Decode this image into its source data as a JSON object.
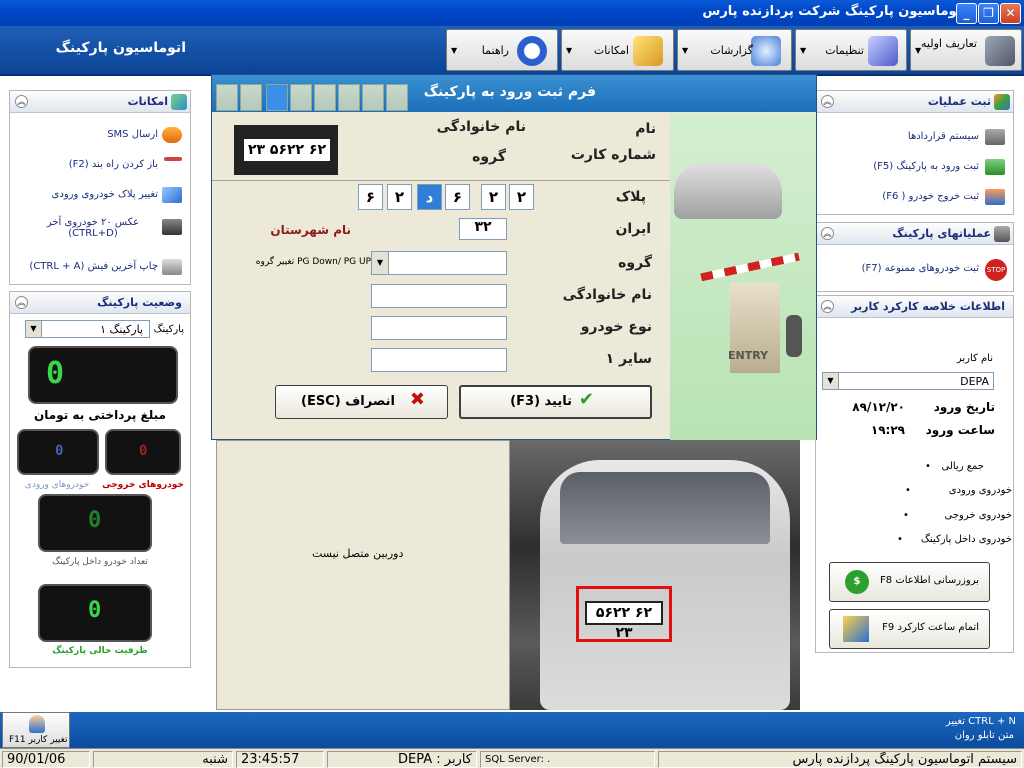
{
  "window": {
    "title": "اتوماسیون پارکینگ شرکت پردازنده پارس",
    "min": "_",
    "max": "❐",
    "close": "✕"
  },
  "app": {
    "title": "اتوماسیون پارکینگ"
  },
  "menu": {
    "initial": "تعاریف اولیه",
    "settings": "تنظیمات",
    "reports": "گزارشات",
    "features": "امکانات",
    "help": "راهنما"
  },
  "left_features": {
    "title": "امکانات",
    "items": [
      {
        "label": "ارسال SMS"
      },
      {
        "label": "باز کردن راه بند (F2)"
      },
      {
        "label": "تغییر پلاک خودروی ورودی"
      },
      {
        "label": "عکس ۲۰ خودروی آخر (CTRL+D)"
      },
      {
        "label": "چاپ آخرین فیش (CTRL + A)"
      }
    ]
  },
  "parking_status": {
    "title": "وضعیت پارکینگ",
    "parking_label": "پارکینگ",
    "parking_value": "پارکینگ ۱",
    "payment_value": "0",
    "payment_caption": "مبلغ پرداختی به تومان",
    "exit_value": "0",
    "exit_caption": "خودروهای خروجی",
    "enter_value": "0",
    "enter_caption": "خودروهای ورودی",
    "inside_value": "0",
    "inside_caption": "تعداد خودرو داخل پارکینگ",
    "free_value": "0",
    "free_caption": "ظرفیت خالی پارکینگ"
  },
  "right_ops": {
    "title": "ثبت عملیات",
    "items": [
      {
        "label": "سیستم قراردادها"
      },
      {
        "label": "ثبت ورود به پارکینگ (F5)"
      },
      {
        "label": "ثبت خروج خودرو ( F6)"
      }
    ]
  },
  "parking_ops": {
    "title": "عملیاتهای پارکینگ",
    "items": [
      {
        "label": "ثبت خودروهای ممنوعه (F7)"
      }
    ]
  },
  "user_summary": {
    "title": "اطلاعات خلاصه کارکرد کاربر",
    "user_label": "نام کاربر",
    "user_value": "DEPA",
    "date_label": "تاریخ ورود",
    "date_value": "۸۹/۱۲/۲۰",
    "time_label": "ساعت ورود",
    "time_value": "۱۹:۲۹",
    "stats": [
      {
        "label": "جمع ریالی",
        "value": "•"
      },
      {
        "label": "خودروی ورودی",
        "value": "•"
      },
      {
        "label": "خودروی خروجی",
        "value": "•"
      },
      {
        "label": "خودروی داخل پارکینگ",
        "value": "•"
      }
    ],
    "update_btn": "بروزرسانی اطلاعات F8",
    "finish_btn": "اتمام ساعت کارکرد F9"
  },
  "dialog": {
    "title": "فرم ثبت ورود به پارکینگ",
    "plate_image_text": "۶۲ ۵۶۲۲ ۲۳",
    "name_label": "نام",
    "family_label": "نام خانوادگی",
    "card_label": "شماره کارت",
    "group_label_top": "گروه",
    "plate_label": "پلاک",
    "plate_boxes": [
      "۲",
      "۲",
      "۶",
      "د",
      "۲",
      "۶"
    ],
    "iran_label": "ایران",
    "iran_value": "۳۲",
    "city_label": "نام شهرستان",
    "group_label": "گروه",
    "group_hint": "PG Down/ PG UP تغییر گروه",
    "family_field_label": "نام خانوادگی",
    "cartype_label": "نوع خودرو",
    "other_label": "سایر ۱",
    "confirm_btn": "تایید        (F3)",
    "cancel_btn": "انصراف (ESC)",
    "entry_label": "ENTRY"
  },
  "camera": {
    "offline_text": "دوربین متصل نیست",
    "plate_text": "۶۲ ۵۶۲۲ ۲۳"
  },
  "footer": {
    "change_user": "تغییر کاربر F11",
    "ctrl_n": "CTRL + N تغییر",
    "marquee": "متن تابلو روان",
    "date": "90/01/06",
    "day": "شنبه",
    "time": "23:45:57",
    "user": "کاربر : DEPA",
    "sql": "SQL Server: .",
    "system": "سیستم اتوماسیون پارکینگ پردازنده پارس"
  },
  "colors": {
    "title_blue": "#0048c8",
    "menu_blue": "#1f5fb6",
    "dialog_bg": "#ece9d8",
    "led_green": "#39d64a"
  }
}
